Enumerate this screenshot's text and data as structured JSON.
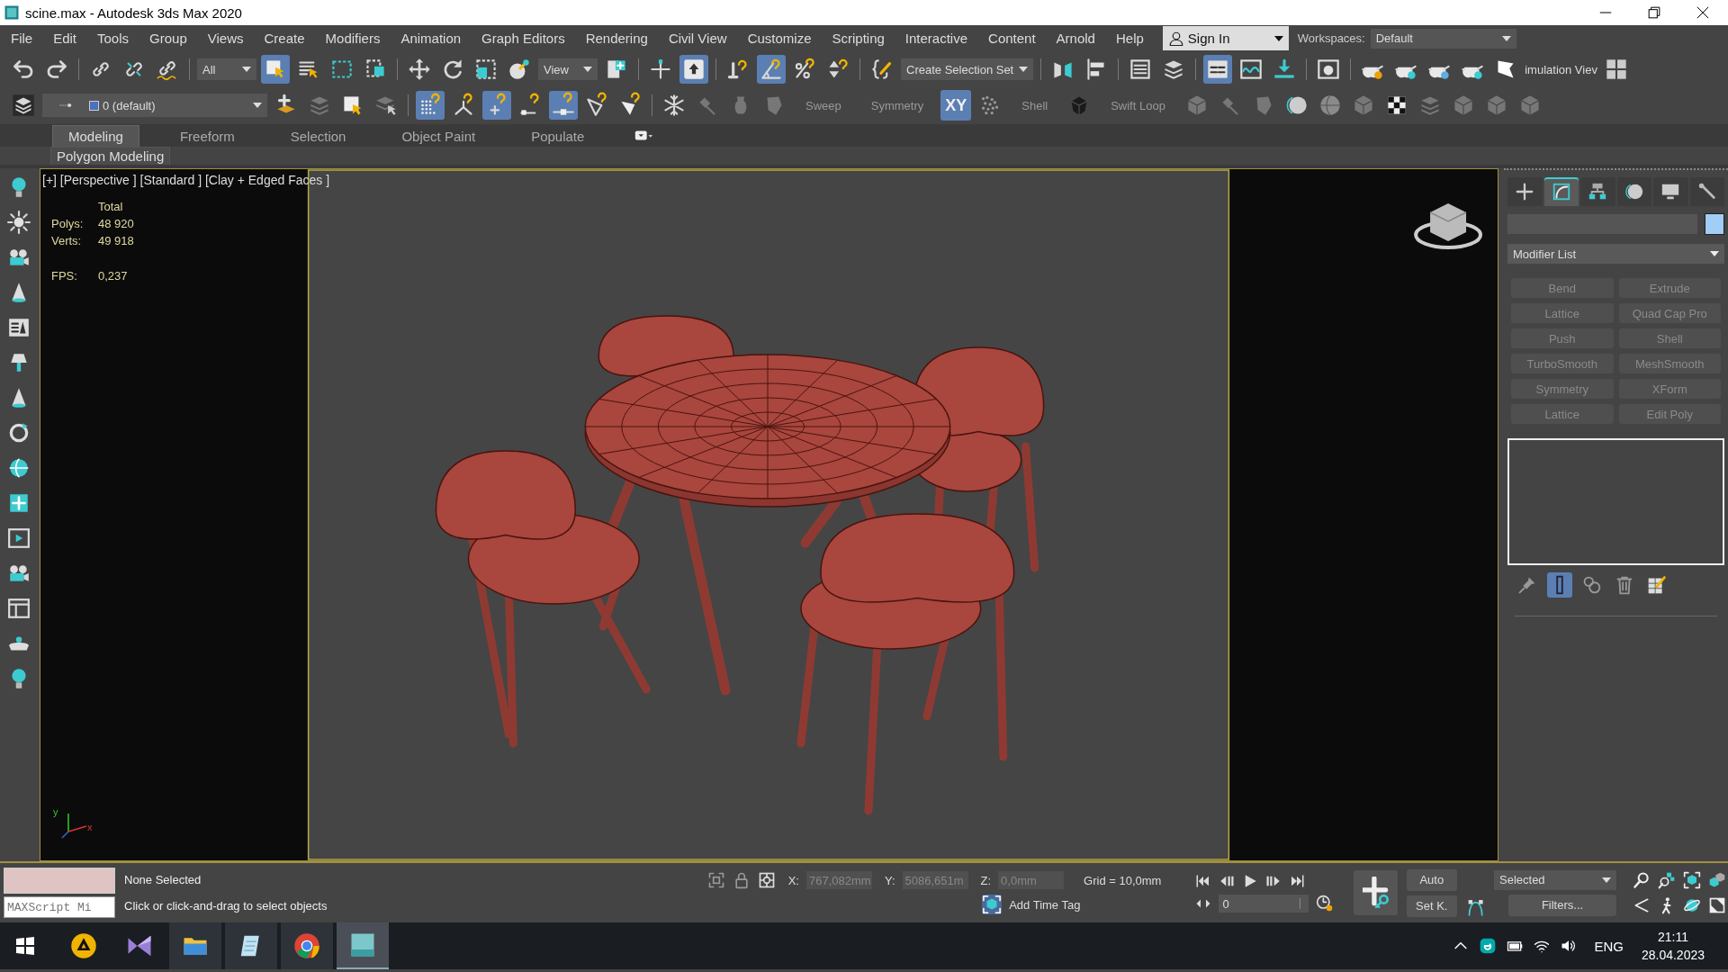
{
  "window": {
    "title": "scine.max - Autodesk 3ds Max 2020"
  },
  "menu": [
    "File",
    "Edit",
    "Tools",
    "Group",
    "Views",
    "Create",
    "Modifiers",
    "Animation",
    "Graph Editors",
    "Rendering",
    "Civil View",
    "Customize",
    "Scripting",
    "Interactive",
    "Content",
    "Arnold",
    "Help"
  ],
  "account": {
    "sign_in": "Sign In",
    "workspaces_label": "Workspaces:",
    "workspace": "Default"
  },
  "main_toolbar": {
    "groups": [
      [
        {
          "kind": "icon",
          "on": false
        },
        {
          "kind": "icon",
          "on": false
        }
      ],
      [
        {
          "kind": "icon",
          "on": false
        },
        {
          "kind": "icon",
          "on": false
        },
        {
          "kind": "icon",
          "on": false
        }
      ],
      [
        {
          "kind": "dropdown",
          "value": "All"
        },
        {
          "kind": "icon",
          "on": true
        },
        {
          "kind": "icon",
          "on": false
        },
        {
          "kind": "icon",
          "on": false
        },
        {
          "kind": "icon",
          "on": false
        }
      ],
      [
        {
          "kind": "icon",
          "on": false
        },
        {
          "kind": "icon",
          "on": false
        },
        {
          "kind": "icon",
          "on": false
        },
        {
          "kind": "icon",
          "on": false
        },
        {
          "kind": "dropdown",
          "value": "View"
        },
        {
          "kind": "icon",
          "on": false
        }
      ],
      [
        {
          "kind": "icon",
          "on": false
        },
        {
          "kind": "icon",
          "on": true
        }
      ],
      [
        {
          "kind": "icon",
          "on": false
        },
        {
          "kind": "icon",
          "on": true
        },
        {
          "kind": "icon",
          "on": false
        },
        {
          "kind": "icon",
          "on": false
        }
      ],
      [
        {
          "kind": "icon",
          "on": false
        },
        {
          "kind": "dropdown",
          "value": "Create Selection Set"
        }
      ],
      [
        {
          "kind": "icon",
          "on": false
        },
        {
          "kind": "icon",
          "on": false
        }
      ],
      [
        {
          "kind": "icon",
          "on": false
        },
        {
          "kind": "icon",
          "on": false
        }
      ],
      [
        {
          "kind": "icon",
          "on": true
        },
        {
          "kind": "icon",
          "on": false
        },
        {
          "kind": "icon",
          "on": false
        }
      ],
      [
        {
          "kind": "icon",
          "on": false
        }
      ],
      [
        {
          "kind": "icon",
          "on": false
        },
        {
          "kind": "icon",
          "on": false
        },
        {
          "kind": "icon",
          "on": false
        },
        {
          "kind": "icon",
          "on": false
        },
        {
          "kind": "icon",
          "on": false
        },
        {
          "kind": "label",
          "text": "imulation Viev"
        },
        {
          "kind": "icon",
          "on": false
        }
      ]
    ]
  },
  "modeling_toolbar": {
    "groups": [
      [
        {
          "kind": "icon",
          "on": false
        },
        {
          "kind": "dropdown",
          "value": "0 (default)"
        },
        {
          "kind": "icon",
          "on": false
        },
        {
          "kind": "icon",
          "on": false
        },
        {
          "kind": "icon",
          "on": false
        },
        {
          "kind": "icon",
          "on": false
        }
      ],
      [
        {
          "kind": "icon",
          "on": true
        },
        {
          "kind": "icon",
          "on": false
        },
        {
          "kind": "icon",
          "on": true
        },
        {
          "kind": "icon",
          "on": false
        },
        {
          "kind": "icon",
          "on": true
        },
        {
          "kind": "icon",
          "on": false
        },
        {
          "kind": "icon",
          "on": false
        }
      ],
      [
        {
          "kind": "icon",
          "on": false
        },
        {
          "kind": "icon",
          "on": false
        },
        {
          "kind": "icon",
          "on": false
        },
        {
          "kind": "icon",
          "on": false
        },
        {
          "kind": "label",
          "text": "Sweep"
        },
        {
          "kind": "label",
          "text": "Symmetry"
        },
        {
          "kind": "text_button",
          "text": "XY",
          "on": true
        },
        {
          "kind": "icon",
          "on": false
        },
        {
          "kind": "label",
          "text": "Shell"
        },
        {
          "kind": "icon",
          "on": false
        },
        {
          "kind": "label",
          "text": "Swift Loop"
        },
        {
          "kind": "icon",
          "on": false
        },
        {
          "kind": "icon",
          "on": false
        },
        {
          "kind": "icon",
          "on": false
        },
        {
          "kind": "icon",
          "on": false
        },
        {
          "kind": "icon",
          "on": false
        },
        {
          "kind": "icon",
          "on": false
        },
        {
          "kind": "icon",
          "on": false
        },
        {
          "kind": "icon",
          "on": false
        },
        {
          "kind": "icon",
          "on": false
        },
        {
          "kind": "icon",
          "on": false
        },
        {
          "kind": "icon",
          "on": false
        }
      ]
    ]
  },
  "ribbon": {
    "tabs": [
      {
        "label": "Modeling",
        "selected": true
      },
      {
        "label": "Freeform",
        "selected": false
      },
      {
        "label": "Selection",
        "selected": false
      },
      {
        "label": "Object Paint",
        "selected": false
      },
      {
        "label": "Populate",
        "selected": false
      }
    ],
    "panel_label": "Polygon Modeling"
  },
  "viewport": {
    "label": "[+] [Perspective ] [Standard ] [Clay + Edged Faces ]",
    "stats_header": "Total",
    "stats": [
      {
        "name": "Polys:",
        "value": "48 920"
      },
      {
        "name": "Verts:",
        "value": "49 918"
      },
      {
        "name": "FPS:",
        "value": "0,237"
      }
    ],
    "axis_labels": [
      "y",
      "x"
    ]
  },
  "command_panel": {
    "tabs": [
      {
        "selected": false
      },
      {
        "selected": true
      },
      {
        "selected": false
      },
      {
        "selected": false
      },
      {
        "selected": false
      },
      {
        "selected": false
      }
    ],
    "modifier_list": "Modifier List",
    "modifier_buttons": [
      {
        "label": "Bend",
        "disabled": true
      },
      {
        "label": "Extrude",
        "disabled": true
      },
      {
        "label": "Lattice",
        "disabled": true
      },
      {
        "label": "Quad Cap Pro",
        "disabled": true
      },
      {
        "label": "Push",
        "disabled": true
      },
      {
        "label": "Shell",
        "disabled": true
      },
      {
        "label": "TurboSmooth",
        "disabled": true
      },
      {
        "label": "MeshSmooth",
        "disabled": true
      },
      {
        "label": "Symmetry",
        "disabled": true
      },
      {
        "label": "XForm",
        "disabled": true
      },
      {
        "label": "Lattice",
        "disabled": true
      },
      {
        "label": "Edit Poly",
        "disabled": true
      }
    ],
    "stack_tools": [
      {
        "on": false
      },
      {
        "on": true
      },
      {
        "on": false
      },
      {
        "on": false
      },
      {
        "on": false
      }
    ]
  },
  "status_bar": {
    "maxscript_placeholder": "MAXScript Mi",
    "selection": "None Selected",
    "prompt": "Click or click-and-drag to select objects",
    "coords": [
      {
        "axis": "X:",
        "value": "767,082mm"
      },
      {
        "axis": "Y:",
        "value": "5086,651m"
      },
      {
        "axis": "Z:",
        "value": "0,0mm"
      }
    ],
    "grid": "Grid = 10,0mm",
    "time_tag": "Add Time Tag",
    "frame": "0",
    "auto_key": "Auto",
    "set_key": "Set K.",
    "key_filter": "Selected",
    "filters": "Filters..."
  },
  "taskbar": {
    "language": "ENG",
    "time": "21:11",
    "date": "28.04.2023"
  }
}
